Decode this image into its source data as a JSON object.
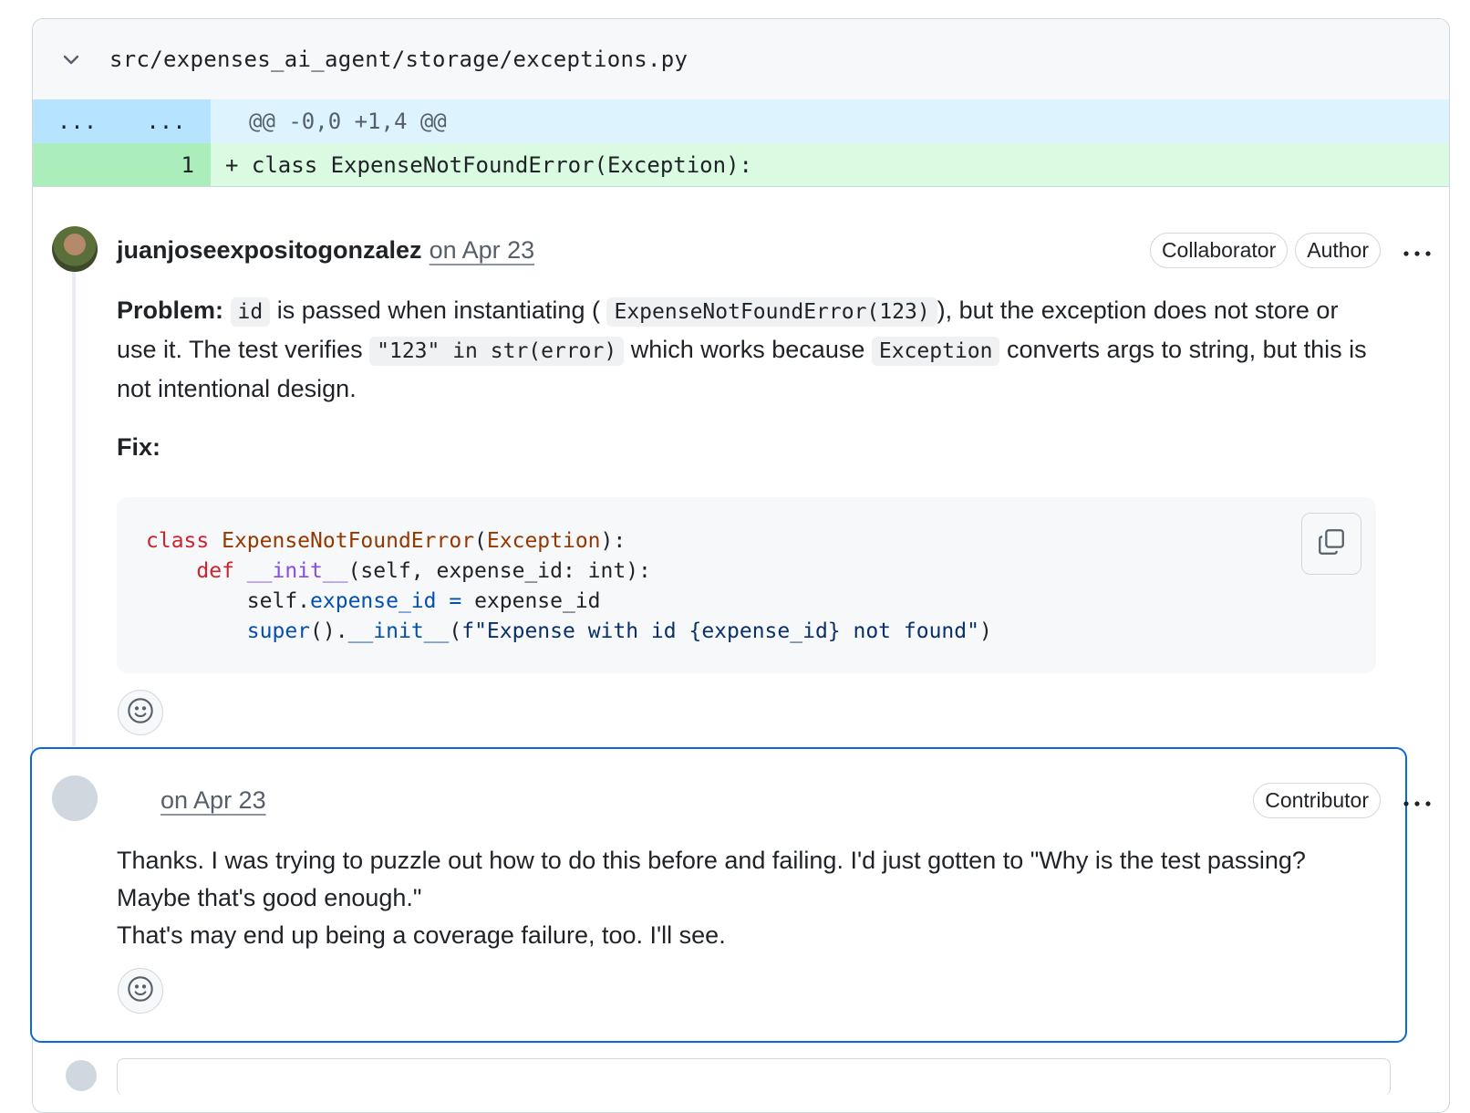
{
  "file": {
    "path": "src/expenses_ai_agent/storage/exceptions.py"
  },
  "diff": {
    "hunk": {
      "old_gutter": "...",
      "new_gutter": "...",
      "header": "@@ -0,0 +1,4 @@"
    },
    "line": {
      "number": "1",
      "text": "+ class ExpenseNotFoundError(Exception):"
    }
  },
  "comments": [
    {
      "author": "juanjoseexpositogonzalez",
      "date": "on Apr 23",
      "badges": [
        "Collaborator",
        "Author"
      ],
      "problem_label": "Problem:",
      "p1": " is passed when instantiating (",
      "code1": "id",
      "code2": "ExpenseNotFoundError(123)",
      "p2": "), but the exception does not store or use it. The test verifies ",
      "code3": "\"123\" in str(error)",
      "p3": " which works because ",
      "code4": "Exception",
      "p4": " converts args to string, but this is not intentional design.",
      "fix_label": "Fix:",
      "code_block": {
        "l1_kw": "class ",
        "l1_cls": "ExpenseNotFoundError",
        "l1_p1": "(",
        "l1_cls2": "Exception",
        "l1_p2": "):",
        "l2_kw": "def ",
        "l2_fn": "__init__",
        "l2_rest": "(self, expense_id: int):",
        "l3_a": "self.",
        "l3_attr": "expense_id",
        "l3_eq": " = ",
        "l3_rest": "expense_id",
        "l4_fn": "super",
        "l4_a": "().",
        "l4_fn2": "__init__",
        "l4_b": "(",
        "l4_str": "f\"Expense with id {expense_id} not found\"",
        "l4_c": ")"
      }
    },
    {
      "author": "",
      "date": "on Apr 23",
      "badges": [
        "Contributor"
      ],
      "line1": "Thanks. I was trying to puzzle out how to do this before and failing. I'd just gotten to \"Why is the test passing? Maybe that's good enough.\"",
      "line2": "That's may end up being a coverage failure, too. I'll see."
    }
  ],
  "menu_icon": "kebab-horizontal-icon",
  "colors": {
    "hunk_bg": "#ddf4ff",
    "added_bg": "#dafbe1",
    "focus_border": "#0969da"
  }
}
